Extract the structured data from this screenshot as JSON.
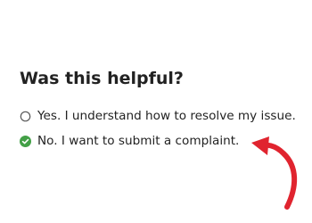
{
  "feedback": {
    "question": "Was this helpful?",
    "options": [
      {
        "label": "Yes. I understand how to resolve my issue.",
        "selected": false
      },
      {
        "label": "No. I want to submit a complaint.",
        "selected": true
      }
    ]
  },
  "colors": {
    "selected_check": "#43a047",
    "radio_border": "#555555",
    "annotation_arrow": "#e0242f"
  },
  "icons": {
    "unselected": "radio-empty-icon",
    "selected": "checkmark-circle-icon",
    "annotation": "curved-arrow-icon"
  }
}
